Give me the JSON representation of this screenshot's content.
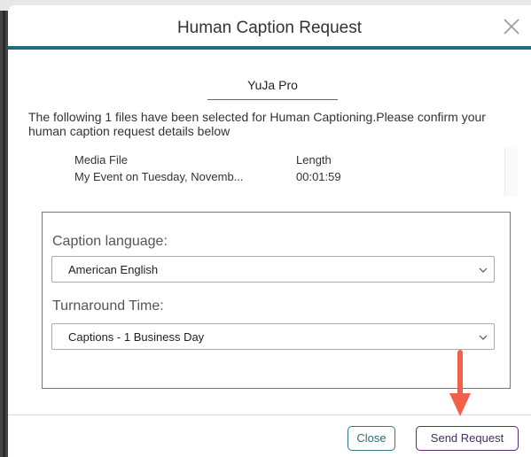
{
  "dialog": {
    "title": "Human Caption Request"
  },
  "account": {
    "name": "YuJa Pro"
  },
  "intro_text": "The following 1 files have been selected for Human Captioning.Please confirm your human caption request details below",
  "files": {
    "columns": [
      "Media File",
      "Length"
    ],
    "rows": [
      [
        "My Event on Tuesday, Novemb...",
        "00:01:59"
      ]
    ]
  },
  "caption_language": {
    "label": "Caption language:",
    "selected": "American English"
  },
  "turnaround": {
    "label": "Turnaround Time:",
    "selected": "Captions - 1 Business Day"
  },
  "footer": {
    "close_label": "Close",
    "send_label": "Send Request"
  },
  "colors": {
    "header_accent": "#1f6c7a",
    "close_button_border": "#2d7a8a",
    "send_button_border": "#5a2c72",
    "annotation_arrow": "#f0604a"
  },
  "icons": {
    "close": "close-x-icon",
    "dropdown": "chevron-down-icon",
    "annotation": "arrow-down-annotation"
  }
}
